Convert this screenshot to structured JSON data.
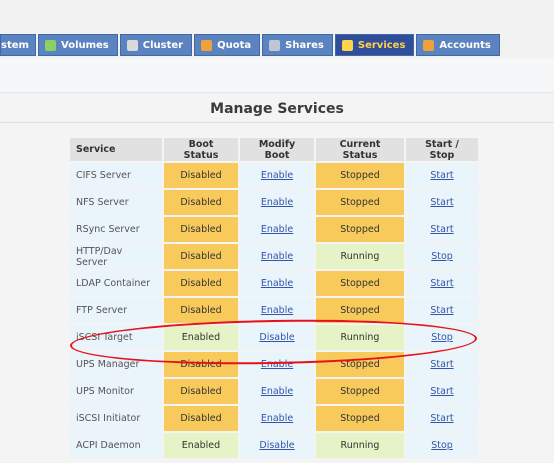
{
  "tabs": [
    {
      "label": "stem",
      "icon": "system-icon",
      "active": false
    },
    {
      "label": "Volumes",
      "icon": "volumes-icon",
      "active": false
    },
    {
      "label": "Cluster",
      "icon": "cluster-icon",
      "active": false
    },
    {
      "label": "Quota",
      "icon": "quota-icon",
      "active": false
    },
    {
      "label": "Shares",
      "icon": "shares-icon",
      "active": false
    },
    {
      "label": "Services",
      "icon": "services-icon",
      "active": true
    },
    {
      "label": "Accounts",
      "icon": "accounts-icon",
      "active": false
    }
  ],
  "page": {
    "title": "Manage Services"
  },
  "table": {
    "headers": [
      "Service",
      "Boot Status",
      "Modify Boot",
      "Current Status",
      "Start / Stop"
    ],
    "rows": [
      {
        "service": "CIFS Server",
        "boot": "Disabled",
        "modify": "Enable",
        "current": "Stopped",
        "action": "Start"
      },
      {
        "service": "NFS Server",
        "boot": "Disabled",
        "modify": "Enable",
        "current": "Stopped",
        "action": "Start"
      },
      {
        "service": "RSync Server",
        "boot": "Disabled",
        "modify": "Enable",
        "current": "Stopped",
        "action": "Start"
      },
      {
        "service": "HTTP/Dav Server",
        "boot": "Disabled",
        "modify": "Enable",
        "current": "Running",
        "action": "Stop"
      },
      {
        "service": "LDAP Container",
        "boot": "Disabled",
        "modify": "Enable",
        "current": "Stopped",
        "action": "Start"
      },
      {
        "service": "FTP Server",
        "boot": "Disabled",
        "modify": "Enable",
        "current": "Stopped",
        "action": "Start"
      },
      {
        "service": "iSCSI Target",
        "boot": "Enabled",
        "modify": "Disable",
        "current": "Running",
        "action": "Stop"
      },
      {
        "service": "UPS Manager",
        "boot": "Disabled",
        "modify": "Enable",
        "current": "Stopped",
        "action": "Start"
      },
      {
        "service": "UPS Monitor",
        "boot": "Disabled",
        "modify": "Enable",
        "current": "Stopped",
        "action": "Start"
      },
      {
        "service": "iSCSI Initiator",
        "boot": "Disabled",
        "modify": "Enable",
        "current": "Stopped",
        "action": "Start"
      },
      {
        "service": "ACPI Daemon",
        "boot": "Enabled",
        "modify": "Disable",
        "current": "Running",
        "action": "Stop"
      }
    ]
  },
  "colors": {
    "disabled": "#f8c95b",
    "enabled": "#e5f3c6",
    "active_tab": "#314e9a",
    "tab": "#5b83c0",
    "annotation": "#e8101a"
  }
}
